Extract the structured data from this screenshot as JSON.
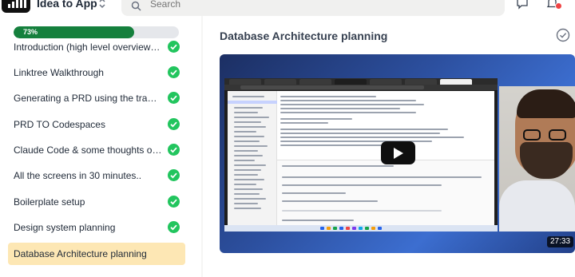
{
  "header": {
    "app_name": "Idea to App",
    "search_placeholder": "Search",
    "switcher_icon": "chevron-up-down-icon",
    "icons": [
      "search-icon",
      "chat-icon",
      "bell-icon"
    ]
  },
  "sidebar": {
    "progress": {
      "label": "73%",
      "value": 0.73
    },
    "lessons": [
      {
        "label": "Introduction (high level overview of t...",
        "completed": true
      },
      {
        "label": "Linktree Walkthrough",
        "completed": true
      },
      {
        "label": "Generating a PRD using the transcript",
        "completed": true
      },
      {
        "label": "PRD TO Codespaces",
        "completed": true
      },
      {
        "label": "Claude Code & some thoughts on w...",
        "completed": true
      },
      {
        "label": "All the screens in 30 minutes..",
        "completed": true
      },
      {
        "label": "Boilerplate setup",
        "completed": true
      },
      {
        "label": "Design system planning",
        "completed": true
      },
      {
        "label": "Database Architecture planning",
        "completed": false,
        "active": true
      }
    ]
  },
  "main": {
    "title": "Database Architecture planning",
    "video": {
      "duration": "27:33"
    }
  },
  "colors": {
    "progress_fill": "#15803d",
    "check": "#22c55e",
    "active_item": "#fde7b4",
    "notification": "#ef4444"
  }
}
